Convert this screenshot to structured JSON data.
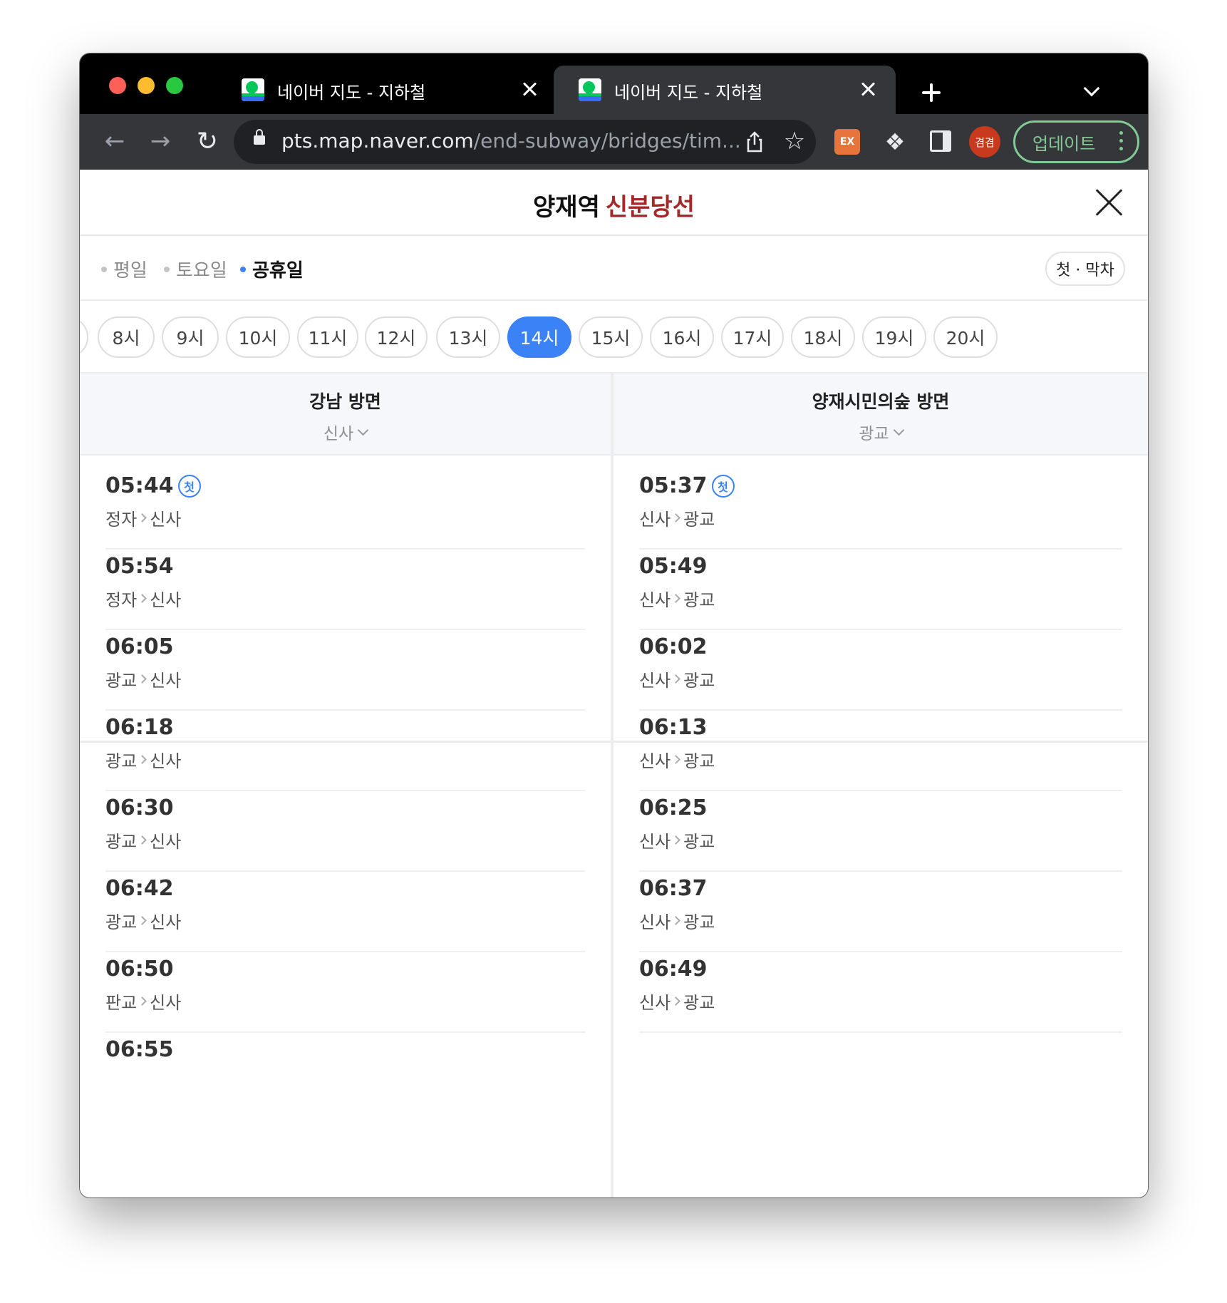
{
  "browser": {
    "tabs": [
      {
        "title": "네이버 지도 - 지하철",
        "active": false
      },
      {
        "title": "네이버 지도 - 지하철",
        "active": true
      }
    ],
    "url_host": "pts.map.naver.com",
    "url_path": "/end-subway/bridges/tim...",
    "ext_label": "EX",
    "avatar_text": "겸겸",
    "update_label": "업데이트"
  },
  "header": {
    "station": "양재역",
    "line": "신분당선",
    "line_color": "#a32929"
  },
  "days": [
    {
      "label": "평일",
      "selected": false
    },
    {
      "label": "토요일",
      "selected": false
    },
    {
      "label": "공휴일",
      "selected": true
    }
  ],
  "first_last_label": "첫 · 막차",
  "hours": [
    "8시",
    "9시",
    "10시",
    "11시",
    "12시",
    "13시",
    "14시",
    "15시",
    "16시",
    "17시",
    "18시",
    "19시",
    "20시"
  ],
  "selected_hour": "14시",
  "accent_color": "#3b82f6",
  "directions": [
    {
      "name": "강남 방면",
      "sub": "신사",
      "trains": [
        {
          "time": "05:44",
          "route_from": "정자",
          "route_to": "신사",
          "badge": "첫"
        },
        {
          "time": "05:54",
          "route_from": "정자",
          "route_to": "신사",
          "badge": ""
        },
        {
          "time": "06:05",
          "route_from": "광교",
          "route_to": "신사",
          "badge": ""
        },
        {
          "time": "06:18",
          "route_from": "광교",
          "route_to": "신사",
          "badge": ""
        },
        {
          "time": "06:30",
          "route_from": "광교",
          "route_to": "신사",
          "badge": ""
        },
        {
          "time": "06:42",
          "route_from": "광교",
          "route_to": "신사",
          "badge": ""
        },
        {
          "time": "06:50",
          "route_from": "판교",
          "route_to": "신사",
          "badge": ""
        },
        {
          "time": "06:55",
          "route_from": "",
          "route_to": "",
          "badge": ""
        }
      ]
    },
    {
      "name": "양재시민의숲 방면",
      "sub": "광교",
      "trains": [
        {
          "time": "05:37",
          "route_from": "신사",
          "route_to": "광교",
          "badge": "첫"
        },
        {
          "time": "05:49",
          "route_from": "신사",
          "route_to": "광교",
          "badge": ""
        },
        {
          "time": "06:02",
          "route_from": "신사",
          "route_to": "광교",
          "badge": ""
        },
        {
          "time": "06:13",
          "route_from": "신사",
          "route_to": "광교",
          "badge": ""
        },
        {
          "time": "06:25",
          "route_from": "신사",
          "route_to": "광교",
          "badge": ""
        },
        {
          "time": "06:37",
          "route_from": "신사",
          "route_to": "광교",
          "badge": ""
        },
        {
          "time": "06:49",
          "route_from": "신사",
          "route_to": "광교",
          "badge": ""
        }
      ]
    }
  ]
}
